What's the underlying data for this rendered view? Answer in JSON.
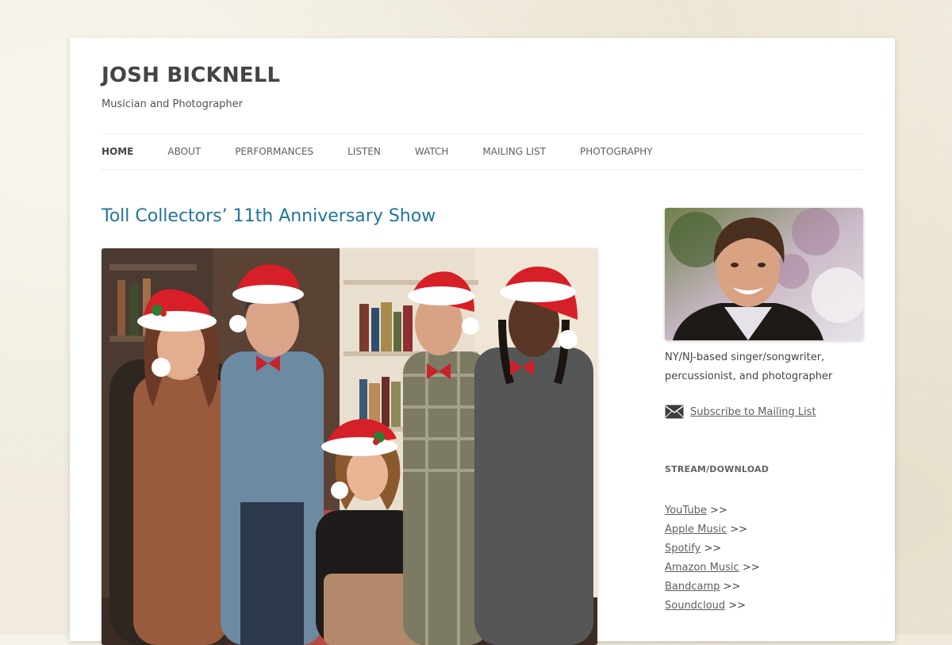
{
  "header": {
    "site_title": "JOSH BICKNELL",
    "site_description": "Musician and Photographer"
  },
  "nav": {
    "items": [
      {
        "label": "HOME",
        "current": true
      },
      {
        "label": "ABOUT"
      },
      {
        "label": "PERFORMANCES"
      },
      {
        "label": "LISTEN"
      },
      {
        "label": "WATCH"
      },
      {
        "label": "MAILING LIST"
      },
      {
        "label": "PHOTOGRAPHY"
      }
    ]
  },
  "post": {
    "title": "Toll Collectors’ 11th Anniversary Show",
    "image_icon": "band-photo-image"
  },
  "sidebar": {
    "avatar_icon": "portrait-photo-image",
    "bio": "NY/NJ-based singer/songwriter, percussionist, and photographer",
    "subscribe_icon": "envelope-icon",
    "subscribe_label": "Subscribe to Mailing List",
    "stream_title": "STREAM/DOWNLOAD",
    "stream_links": [
      {
        "label": "YouTube",
        "suffix": ">>"
      },
      {
        "label": "Apple Music",
        "suffix": ">>"
      },
      {
        "label": "Spotify",
        "suffix": ">>"
      },
      {
        "label": "Amazon Music",
        "suffix": ">>"
      },
      {
        "label": "Bandcamp",
        "suffix": ">>"
      },
      {
        "label": "Soundcloud",
        "suffix": ">>"
      }
    ]
  },
  "colors": {
    "link_blue": "#21759b",
    "text": "#444444",
    "background": "#f0ebdd"
  }
}
